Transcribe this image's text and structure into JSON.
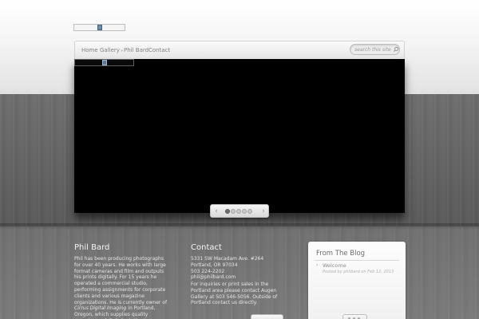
{
  "site": {
    "nav": [
      {
        "label": "Home"
      },
      {
        "label": "Gallery",
        "has_dropdown": true,
        "arrow": "»"
      },
      {
        "label": "Phil Bard"
      },
      {
        "label": "Contact"
      }
    ],
    "search": {
      "placeholder": "search this site...",
      "icon": "search-icon"
    }
  },
  "slider": {
    "prev_arrow": "‹",
    "next_arrow": "›",
    "dot_count": 5,
    "active_dot": 1
  },
  "about": {
    "title": "Phil Bard",
    "bio_part1": "Phil has been producing photographs for over 40 years.  He works with large format cameras and film and outputs his prints digitally. For 15 years he operated a commercial studio, performing assignments for corporate clients and various magazine organizations. He is currently owner of ",
    "bio_em": "Cirrus Digital Imaging",
    "bio_part2": " in Portland, Oregon, which supplies quality scanning and digital printing to a variety of clients."
  },
  "contact": {
    "title": "Contact",
    "address1": "5331 SW Macadam Ave. #264",
    "address2": "Portland, OR 97034",
    "phone": "503 224-2202",
    "email": "phil@philbard.com",
    "note": "For inquiries or print sales in the Portland area please contact Augen Gallery at 503 546-5056. Outside of Portland contact us directly."
  },
  "blog": {
    "title": "From The Blog",
    "posts": [
      {
        "title": "Welcome",
        "meta": "Posted by philbard on Feb 12, 2013"
      }
    ]
  },
  "colors": {
    "wood": "#5e5e5e",
    "slider_bg": "#000000",
    "nav_text": "#7f7f7f"
  }
}
